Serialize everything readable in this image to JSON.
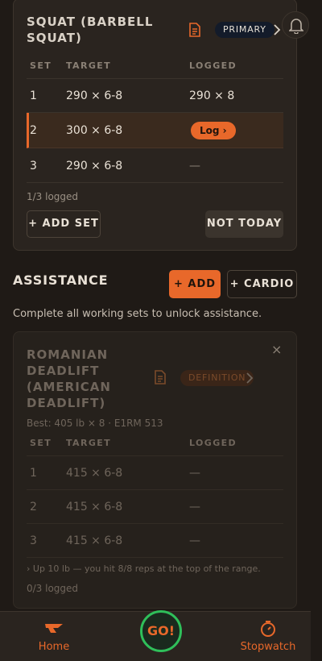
{
  "primary_exercise": {
    "title": "SQUAT (BARBELL SQUAT)",
    "badge": "PRIMARY",
    "columns": [
      "SET",
      "TARGET",
      "LOGGED"
    ],
    "rows": [
      {
        "set": "1",
        "target": "290 × 6-8",
        "logged": "290 × 8"
      },
      {
        "set": "2",
        "target": "300 × 6-8",
        "logged": "Log ›"
      },
      {
        "set": "3",
        "target": "290 × 6-8",
        "logged": "—"
      }
    ],
    "logged_count": "1/3 logged",
    "add_set_label": "+ ADD SET",
    "not_today_label": "NOT TODAY"
  },
  "assistance": {
    "title": "ASSISTANCE",
    "add_label": "+ ADD",
    "cardio_label": "+ CARDIO",
    "subtitle": "Complete all working sets to unlock assistance."
  },
  "assist_exercise": {
    "title": "ROMANIAN DEADLIFT (AMERICAN DEADLIFT)",
    "badge": "DEFINITION",
    "close_label": "×",
    "best": "Best: 405 lb × 8 · E1RM 513",
    "columns": [
      "SET",
      "TARGET",
      "LOGGED"
    ],
    "rows": [
      {
        "set": "1",
        "target": "415 × 6-8",
        "logged": "—"
      },
      {
        "set": "2",
        "target": "415 × 6-8",
        "logged": "—"
      },
      {
        "set": "3",
        "target": "415 × 6-8",
        "logged": "—"
      }
    ],
    "hint": "› Up 10 lb — you hit 8/8 reps at the top of the range.",
    "logged_count": "0/3 logged"
  },
  "nav": {
    "home_label": "Home",
    "go_label": "GO!",
    "stopwatch_label": "Stopwatch"
  },
  "colors": {
    "accent": "#e8682a",
    "go_ring": "#2fbf5a",
    "background": "#1f1a16",
    "card": "#2a241f"
  },
  "icons": [
    "note-icon",
    "chevron-right-icon",
    "bell-icon",
    "close-icon",
    "home-icon",
    "stopwatch-icon"
  ]
}
